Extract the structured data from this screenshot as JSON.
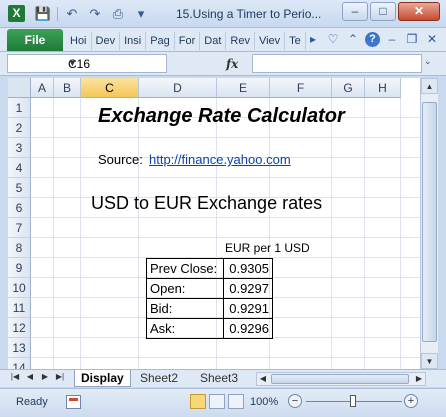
{
  "window": {
    "title": "15.Using a Timer to Perio...",
    "controls": [
      "–",
      "□",
      "✕"
    ]
  },
  "app_icon": "X",
  "quick_access": [
    "save-icon",
    "undo-icon",
    "redo-icon",
    "customize-icon"
  ],
  "ribbon": {
    "file_tab": "File",
    "tabs": [
      "Hoi",
      "Dev",
      "Insi",
      "Pag",
      "For",
      "Dat",
      "Rev",
      "Viev",
      "Te"
    ]
  },
  "formula_bar": {
    "name_box": "C16",
    "fx": "fx",
    "formula": ""
  },
  "columns": [
    "A",
    "B",
    "C",
    "D",
    "E",
    "F",
    "G",
    "H"
  ],
  "selected_column": "C",
  "rows": [
    "1",
    "2",
    "3",
    "4",
    "5",
    "6",
    "7",
    "8",
    "9",
    "10",
    "11",
    "12",
    "13",
    "14"
  ],
  "sheet": {
    "title": "Exchange Rate Calculator",
    "source_label": "Source:",
    "source_link": "http://finance.yahoo.com",
    "subheading": "USD to EUR Exchange rates",
    "unit_label": "EUR per 1 USD",
    "rates": [
      {
        "label": "Prev Close:",
        "value": "0.9305"
      },
      {
        "label": "Open:",
        "value": "0.9297"
      },
      {
        "label": "Bid:",
        "value": "0.9291"
      },
      {
        "label": "Ask:",
        "value": "0.9296"
      }
    ]
  },
  "sheet_tabs": [
    "Display",
    "Sheet2",
    "Sheet3"
  ],
  "active_sheet": "Display",
  "status": {
    "ready": "Ready",
    "zoom": "100%",
    "zoom_out": "−",
    "zoom_in": "+"
  }
}
